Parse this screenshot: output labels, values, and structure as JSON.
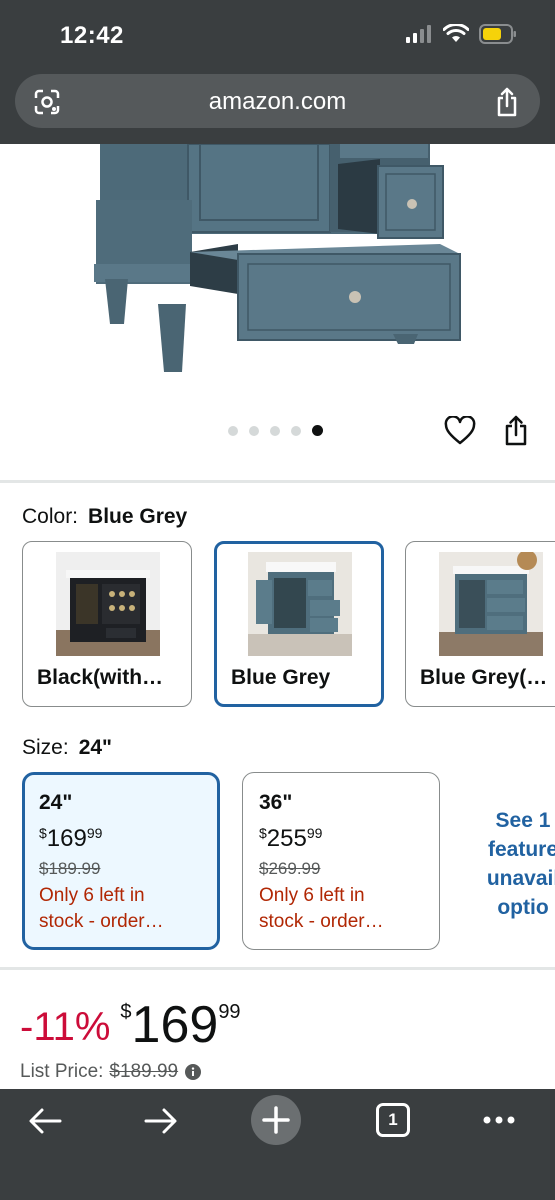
{
  "status": {
    "time": "12:42"
  },
  "browser": {
    "url": "amazon.com",
    "tab_count": "1"
  },
  "carousel": {
    "total": 5,
    "active": 4
  },
  "color": {
    "label": "Color:",
    "value": "Blue Grey",
    "options": [
      {
        "name": "Black(with…"
      },
      {
        "name": "Blue Grey"
      },
      {
        "name": "Blue Grey(…"
      }
    ]
  },
  "size": {
    "label": "Size:",
    "value": "24\"",
    "options": [
      {
        "size": "24\"",
        "currency": "$",
        "price_whole": "169",
        "price_cents": "99",
        "list_price": "$189.99",
        "stock_line1": "Only 6 left in",
        "stock_line2": "stock - order…"
      },
      {
        "size": "36\"",
        "currency": "$",
        "price_whole": "255",
        "price_cents": "99",
        "list_price": "$269.99",
        "stock_line1": "Only 6 left in",
        "stock_line2": "stock - order…"
      }
    ],
    "see_more_lines": [
      "See 1",
      "feature",
      "unavail",
      "optio"
    ]
  },
  "price": {
    "discount": "-11%",
    "currency": "$",
    "whole": "169",
    "cents": "99",
    "list_label": "List Price:",
    "list_value": "$189.99"
  },
  "colors": {
    "link": "#2162a1",
    "deal": "#cc0c39",
    "stock": "#b12704",
    "chrome": "#3a3e40"
  }
}
